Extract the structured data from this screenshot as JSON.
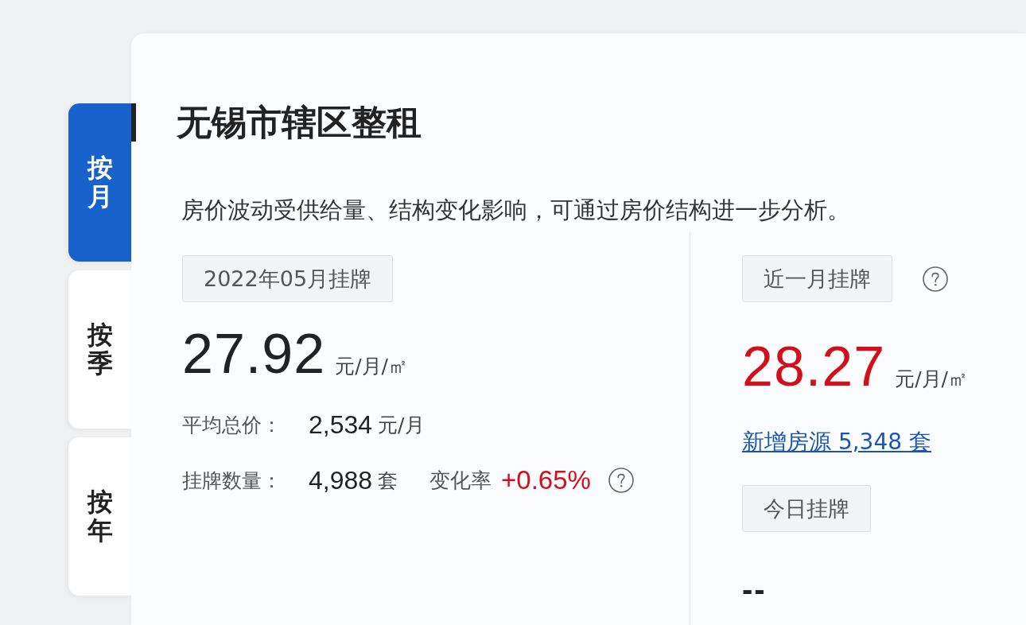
{
  "tabs": [
    {
      "label": "按月",
      "selected": true
    },
    {
      "label": "按季",
      "selected": false
    },
    {
      "label": "按年",
      "selected": false
    }
  ],
  "title": "无锡市辖区整租",
  "description": "房价波动受供给量、结构变化影响，可通过房价结构进一步分析。",
  "monthly_listing": {
    "tag": "2022年05月挂牌",
    "price": "27.92",
    "price_unit": "元/月/㎡",
    "average_total": {
      "label": "平均总价：",
      "value": "2,534",
      "unit": "元/月"
    },
    "listing_count": {
      "label": "挂牌数量：",
      "value": "4,988",
      "unit": "套"
    },
    "change_rate": {
      "label": "变化率",
      "value": "+0.65%"
    }
  },
  "recent_month": {
    "tag": "近一月挂牌",
    "price": "28.27",
    "price_unit": "元/月/㎡",
    "new_listings": "新增房源 5,348 套"
  },
  "today": {
    "tag": "今日挂牌",
    "value": "--"
  }
}
